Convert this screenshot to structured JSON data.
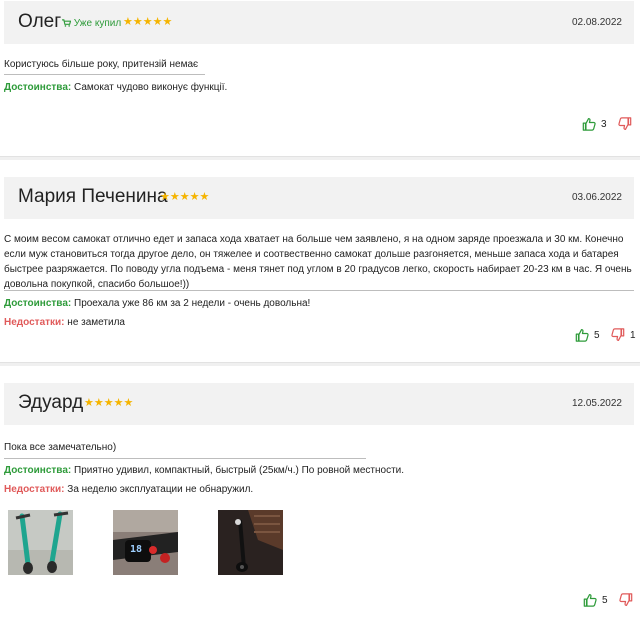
{
  "reviews": [
    {
      "name": "Олег",
      "rating_stars": "★★★★★",
      "rating": 5,
      "bought_label": "Уже купил",
      "date": "02.08.2022",
      "text": "Користуюсь більше року, притензій немає",
      "pros_label": "Достоинства:",
      "pros": "Самокат чудово виконує функції.",
      "likes": "3",
      "dislikes": ""
    },
    {
      "name": "Мария Печенина",
      "rating_stars": "★★★★★",
      "rating": 5,
      "date": "03.06.2022",
      "text": "С моим весом самокат отлично едет и запаса хода хватает на больше чем заявлено, я на одном заряде проезжала и 30 км. Конечно если муж становиться тогда другое дело, он тяжелее и соотвественно самокат дольше разгоняется, меньше запаса хода и батарея быстрее разряжается. По поводу угла подъема - меня тянет под углом в 20 градусов легко, скорость набирает 20-23 км в час. Я очень довольна покупкой, спасибо большое!))",
      "pros_label": "Достоинства:",
      "pros": "Проехала уже 86 км за 2 недели - очень довольна!",
      "cons_label": "Недостатки:",
      "cons": "не заметила",
      "likes": "5",
      "dislikes": "1"
    },
    {
      "name": "Эдуард",
      "rating_stars": "★★★★★",
      "rating": 5,
      "date": "12.05.2022",
      "text": "Пока все замечательно)",
      "pros_label": "Достоинства:",
      "pros": "Приятно удивил, компактный, быстрый (25км/ч.) По ровной местности.",
      "cons_label": "Недостатки:",
      "cons": "За неделю эксплуатации не обнаружил.",
      "photo_display_text": "18",
      "likes": "5",
      "dislikes": ""
    }
  ],
  "colors": {
    "pros": "#2e9b3a",
    "cons": "#e05a5a",
    "star": "#f5b400",
    "header_bg": "#f2f2f2"
  },
  "icons": {
    "like": "thumbs-up-icon",
    "dislike": "thumbs-down-icon",
    "cart": "cart-icon"
  }
}
